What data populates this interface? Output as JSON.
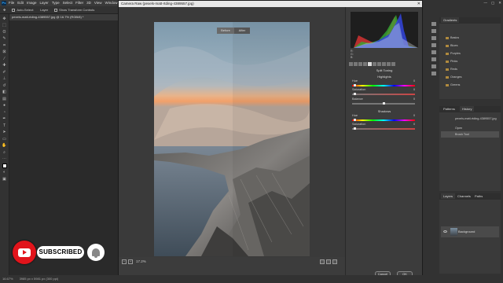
{
  "app": {
    "logo": "Ps",
    "menu": [
      "File",
      "Edit",
      "Image",
      "Layer",
      "Type",
      "Select",
      "Filter",
      "3D",
      "View",
      "Window",
      "Help"
    ]
  },
  "options": {
    "auto_select_label": "Auto-Select:",
    "auto_select_value": "Layer",
    "show_transform_label": "Show Transform Controls"
  },
  "document": {
    "tab_label": "pexels-matt-rtding-4389557.jpg @ 16.7% (RGB/8) *"
  },
  "status": {
    "zoom": "16.67%",
    "doc_size": "3985 px x 5981 px (300 ppi)"
  },
  "overlay": {
    "subscribe_label": "SUBSCRIBED",
    "youtube_icon": "youtube-play-icon",
    "bell_icon": "bell-icon"
  },
  "camera_raw": {
    "title": "Camera Raw (pexels-matt-rtding-4389557.jpg)",
    "before_label": "Before",
    "after_label": "After",
    "zoom_value": "17.2%",
    "rgb_r": "R:",
    "rgb_g": "G:",
    "rgb_b": "B:",
    "section_title": "Split Toning",
    "highlights_title": "Highlights",
    "shadows_title": "Shadows",
    "hue_label": "Hue",
    "saturation_label": "Saturation",
    "balance_label": "Balance",
    "shadows_hue_label": "Hue",
    "shadows_saturation_label": "Saturation",
    "hl_hue_value": "0",
    "hl_sat_value": "0",
    "balance_value": "0",
    "sh_hue_value": "0",
    "sh_sat_value": "0",
    "sliders": {
      "hl_hue": 0.02,
      "hl_sat": 0.02,
      "balance": 0.5,
      "sh_hue": 0.02,
      "sh_sat": 0.02
    },
    "cancel_label": "Cancel",
    "ok_label": "OK"
  },
  "swatches_panel": {
    "tab": "Gradients",
    "folders": [
      "Basics",
      "Blues",
      "Purples",
      "Pinks",
      "Reds",
      "Oranges",
      "Greens"
    ]
  },
  "history_panel": {
    "tabs": [
      "Patterns",
      "History"
    ],
    "snapshot_label": "pexels-matt-rtding-4389557.jpg",
    "states": [
      "Open",
      "Brush Tool"
    ]
  },
  "layers_panel": {
    "tabs": [
      "Layers",
      "Channels",
      "Paths"
    ],
    "layer_name": "Background"
  },
  "colors": {
    "accent": "#e1141b",
    "dialog_title_bg": "#e8e8e8"
  }
}
